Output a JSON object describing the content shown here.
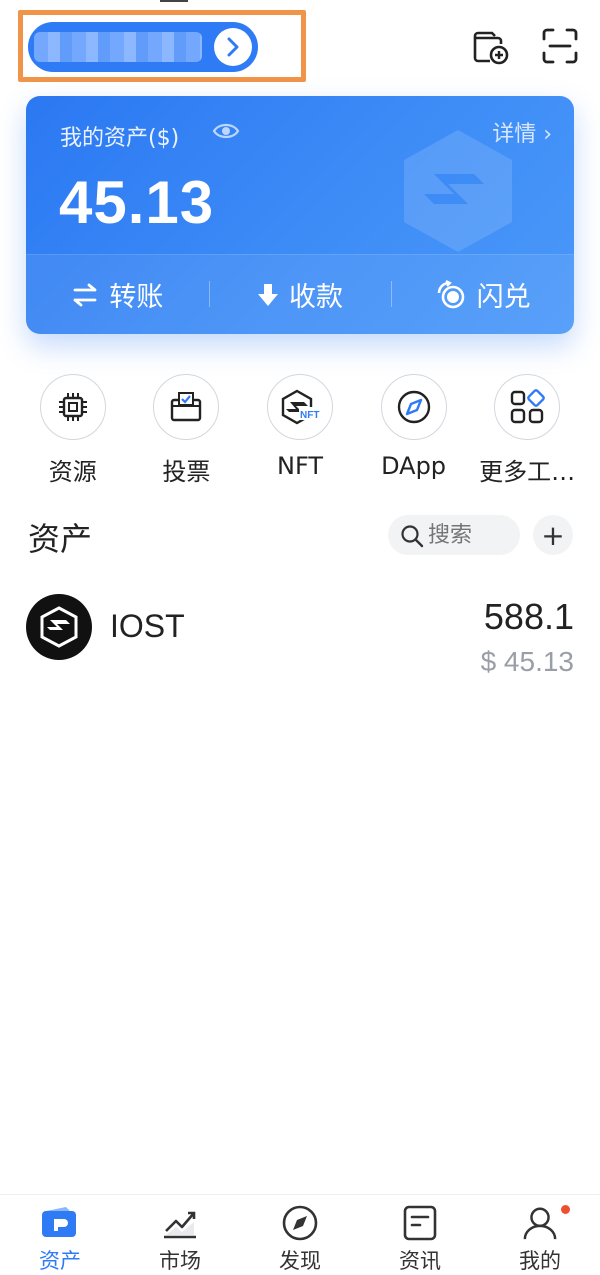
{
  "colors": {
    "accent": "#2f7bf5",
    "highlight_border": "#f0944a",
    "notification_dot": "#f04f2b"
  },
  "header": {
    "wallet_selector_icon": "chevron-right-icon",
    "add_wallet_icon": "wallet-add-icon",
    "scan_icon": "scan-icon"
  },
  "asset_card": {
    "label": "我的资产($)",
    "eye_icon": "eye-icon",
    "detail_link": "详情 ›",
    "total": "45.13",
    "actions": [
      {
        "label": "转账",
        "icon": "transfer-icon"
      },
      {
        "label": "收款",
        "icon": "download-arrow-icon"
      },
      {
        "label": "闪兑",
        "icon": "swap-icon"
      }
    ]
  },
  "shortcuts": [
    {
      "label": "资源",
      "icon": "chip-icon"
    },
    {
      "label": "投票",
      "icon": "ballot-box-icon"
    },
    {
      "label": "NFT",
      "icon": "nft-icon"
    },
    {
      "label": "DApp",
      "icon": "compass-icon"
    },
    {
      "label": "更多工…",
      "icon": "grid-icon"
    }
  ],
  "assets": {
    "title": "资产",
    "search_placeholder": "搜索",
    "add_label": "+",
    "tokens": [
      {
        "name": "IOST",
        "balance": "588.1",
        "value": "$ 45.13",
        "icon": "iost-logo-icon"
      }
    ]
  },
  "tabbar": {
    "tabs": [
      {
        "label": "资产",
        "icon": "wallet-icon",
        "active": true
      },
      {
        "label": "市场",
        "icon": "chart-trend-icon",
        "active": false
      },
      {
        "label": "发现",
        "icon": "compass-icon",
        "active": false
      },
      {
        "label": "资讯",
        "icon": "news-icon",
        "active": false
      },
      {
        "label": "我的",
        "icon": "user-icon",
        "active": false,
        "badge": true
      }
    ]
  }
}
